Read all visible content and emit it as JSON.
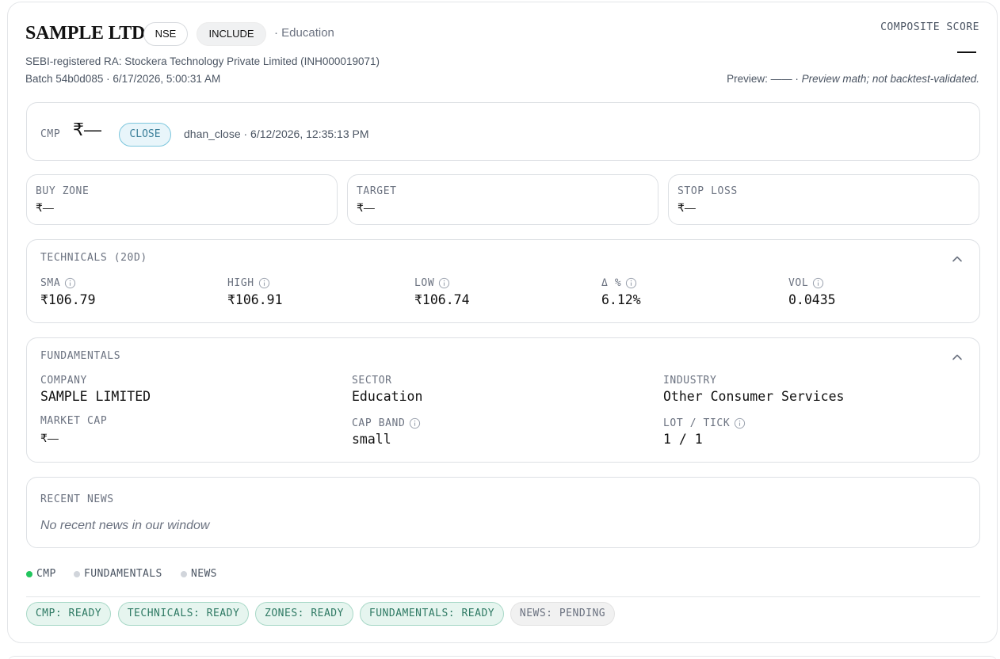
{
  "header": {
    "company_name": "SAMPLE LTD",
    "exchange": "NSE",
    "verdict": "INCLUDE",
    "sector_inline": "· Education",
    "ra_line": "SEBI-registered RA: Stockera Technology Private Limited (INH000019071)",
    "batch_line": "Batch 54b0d085 · 6/17/2026, 5:00:31 AM",
    "composite_label": "COMPOSITE SCORE",
    "composite_value": "—",
    "preview_prefix": "Preview: —— · ",
    "preview_note": "Preview math; not backtest-validated."
  },
  "cmp": {
    "label": "CMP",
    "value": "₹—",
    "price_type": "CLOSE",
    "source": "dhan_close · 6/12/2026, 12:35:13 PM"
  },
  "zones": {
    "buy": {
      "label": "BUY ZONE",
      "value": "₹—"
    },
    "target": {
      "label": "TARGET",
      "value": "₹—"
    },
    "stop": {
      "label": "STOP LOSS",
      "value": "₹—"
    }
  },
  "technicals": {
    "title": "TECHNICALS (20D)",
    "metrics": [
      {
        "label": "SMA",
        "value": "₹106.79"
      },
      {
        "label": "HIGH",
        "value": "₹106.91"
      },
      {
        "label": "LOW",
        "value": "₹106.74"
      },
      {
        "label": "Δ %",
        "value": "6.12%"
      },
      {
        "label": "VOL",
        "value": "0.0435"
      }
    ]
  },
  "fundamentals": {
    "title": "FUNDAMENTALS",
    "company": {
      "label": "COMPANY",
      "value": "SAMPLE LIMITED"
    },
    "sector": {
      "label": "SECTOR",
      "value": "Education"
    },
    "industry": {
      "label": "INDUSTRY",
      "value": "Other Consumer Services"
    },
    "market_cap": {
      "label": "MARKET CAP",
      "value": "₹—"
    },
    "cap_band": {
      "label": "CAP BAND",
      "value": "small"
    },
    "lot_tick": {
      "label": "LOT / TICK",
      "value": "1 / 1"
    }
  },
  "news": {
    "title": "RECENT NEWS",
    "empty_text": "No recent news in our window"
  },
  "legend": [
    {
      "label": "CMP",
      "color": "#22c55e"
    },
    {
      "label": "FUNDAMENTALS",
      "color": "#d1d5db"
    },
    {
      "label": "NEWS",
      "color": "#d1d5db"
    }
  ],
  "status_pills": [
    {
      "label": "CMP: READY",
      "state": "ready"
    },
    {
      "label": "TECHNICALS: READY",
      "state": "ready"
    },
    {
      "label": "ZONES: READY",
      "state": "ready"
    },
    {
      "label": "FUNDAMENTALS: READY",
      "state": "ready"
    },
    {
      "label": "NEWS: PENDING",
      "state": "pending"
    }
  ],
  "colors": {
    "ready_bg": "#e6f5ef",
    "ready_text": "#2f7a64",
    "close_pill_bg": "#e8f5fa",
    "close_pill_text": "#3b7f99",
    "live_dot": "#22c55e"
  }
}
